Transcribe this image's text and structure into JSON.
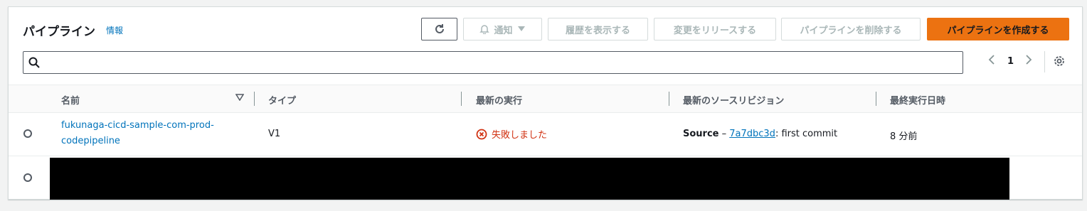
{
  "header": {
    "title": "パイプライン",
    "info_link": "情報",
    "buttons": {
      "notify": "通知",
      "history": "履歴を表示する",
      "release": "変更をリリースする",
      "delete": "パイプラインを削除する",
      "create": "パイプラインを作成する"
    }
  },
  "search": {
    "value": "",
    "placeholder": ""
  },
  "pagination": {
    "current_page": "1"
  },
  "table": {
    "columns": [
      "名前",
      "タイプ",
      "最新の実行",
      "最新のソースリビジョン",
      "最終実行日時"
    ],
    "rows": [
      {
        "name_line1": "fukunaga-cicd-sample-com-prod-",
        "name_line2": "codepipeline",
        "type": "V1",
        "status": "失敗しました",
        "source_label": "Source",
        "source_dash": " – ",
        "commit_id": "7a7dbc3d",
        "commit_message": ": first commit",
        "last_run": "8 分前"
      }
    ]
  },
  "colors": {
    "accent": "#ec7211",
    "link": "#0073bb",
    "error": "#d13212"
  }
}
